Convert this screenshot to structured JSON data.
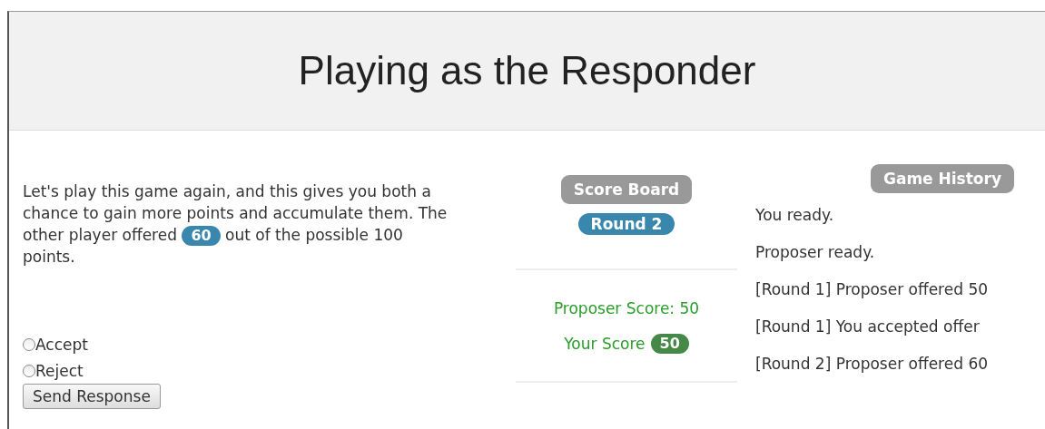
{
  "header": {
    "title": "Playing as the Responder"
  },
  "prompt": {
    "before": "Let's play this game again, and this gives you both a chance to gain more points and accumulate them. The other player offered",
    "offer": "60",
    "after": "out of the possible 100 points."
  },
  "options": [
    {
      "label": "Accept",
      "selected": false
    },
    {
      "label": "Reject",
      "selected": false
    }
  ],
  "submit_button": "Send Response",
  "score_board": {
    "title": "Score Board",
    "round": "Round 2",
    "proposer_score": "Proposer Score: 50",
    "your_score_label": "Your Score",
    "your_score": "50"
  },
  "game_history": {
    "title": "Game History",
    "entries": [
      "You ready.",
      "Proposer ready.",
      "[Round 1] Proposer offered 50",
      "[Round 1] You accepted offer",
      "[Round 2] Proposer offered 60"
    ]
  }
}
